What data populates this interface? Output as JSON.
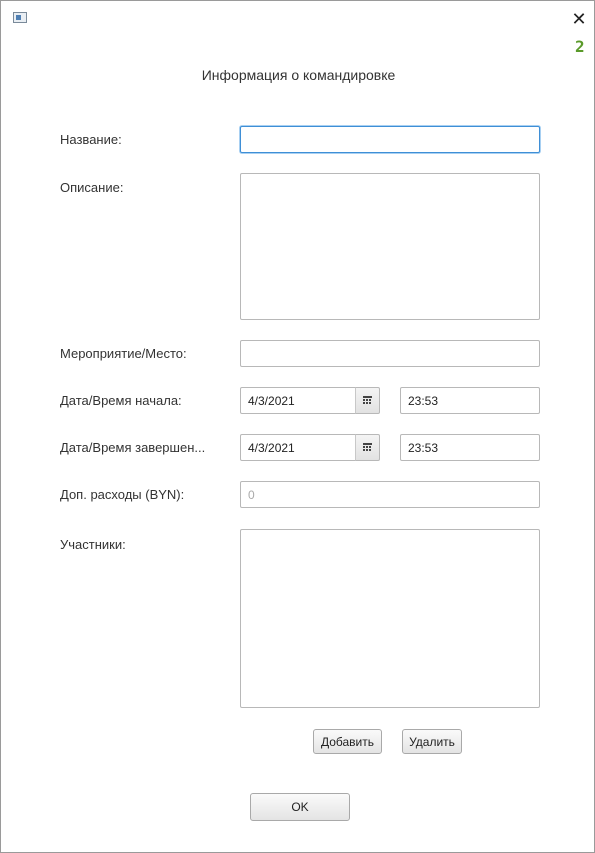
{
  "window": {
    "icon": "window-app-icon",
    "close_glyph": "✕",
    "side_glyph": "2"
  },
  "dialog": {
    "title": "Информация о командировке"
  },
  "form": {
    "name": {
      "label": "Название:",
      "value": ""
    },
    "description": {
      "label": "Описание:",
      "value": ""
    },
    "event_place": {
      "label": "Мероприятие/Место:",
      "value": ""
    },
    "start": {
      "label": "Дата/Время начала:",
      "date": "4/3/2021",
      "time": "23:53"
    },
    "end": {
      "label": "Дата/Время завершен...",
      "date": "4/3/2021",
      "time": "23:53"
    },
    "expenses": {
      "label": "Доп. расходы (BYN):",
      "placeholder": "0"
    },
    "participants": {
      "label": "Участники:"
    }
  },
  "buttons": {
    "add": "Добавить",
    "remove": "Удалить",
    "ok": "OK"
  },
  "colors": {
    "focus_border": "#3f8fd6",
    "accent_glyph": "#5a9a2a"
  }
}
